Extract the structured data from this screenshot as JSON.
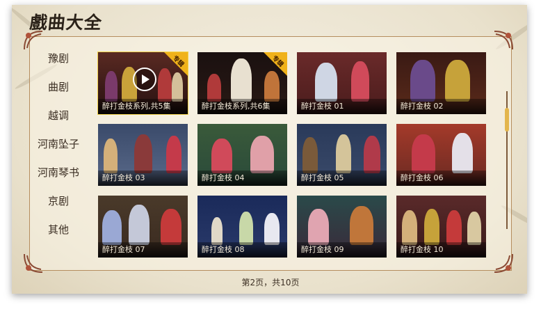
{
  "app": {
    "title": "戲曲大全"
  },
  "sidebar": {
    "items": [
      {
        "label": "豫剧"
      },
      {
        "label": "曲剧"
      },
      {
        "label": "越调"
      },
      {
        "label": "河南坠子"
      },
      {
        "label": "河南琴书"
      },
      {
        "label": "京剧"
      },
      {
        "label": "其他"
      }
    ]
  },
  "grid": {
    "tiles": [
      {
        "title": "醉打金枝系列,共5集",
        "badge": "专辑",
        "selected": true
      },
      {
        "title": "醉打金枝系列,共6集",
        "badge": "专辑",
        "selected": false
      },
      {
        "title": "醉打金枝 01",
        "badge": "",
        "selected": false
      },
      {
        "title": "醉打金枝 02",
        "badge": "",
        "selected": false
      },
      {
        "title": "醉打金枝 03",
        "badge": "",
        "selected": false
      },
      {
        "title": "醉打金枝 04",
        "badge": "",
        "selected": false
      },
      {
        "title": "醉打金枝 05",
        "badge": "",
        "selected": false
      },
      {
        "title": "醉打金枝 06",
        "badge": "",
        "selected": false
      },
      {
        "title": "醉打金枝 07",
        "badge": "",
        "selected": false
      },
      {
        "title": "醉打金枝 08",
        "badge": "",
        "selected": false
      },
      {
        "title": "醉打金枝 09",
        "badge": "",
        "selected": false
      },
      {
        "title": "醉打金枝 10",
        "badge": "",
        "selected": false
      }
    ]
  },
  "pagination": {
    "text": "第2页，共10页"
  },
  "colors": {
    "accent": "#f2d34a",
    "badge": "#f0b21a",
    "frame": "#b58d5e"
  }
}
